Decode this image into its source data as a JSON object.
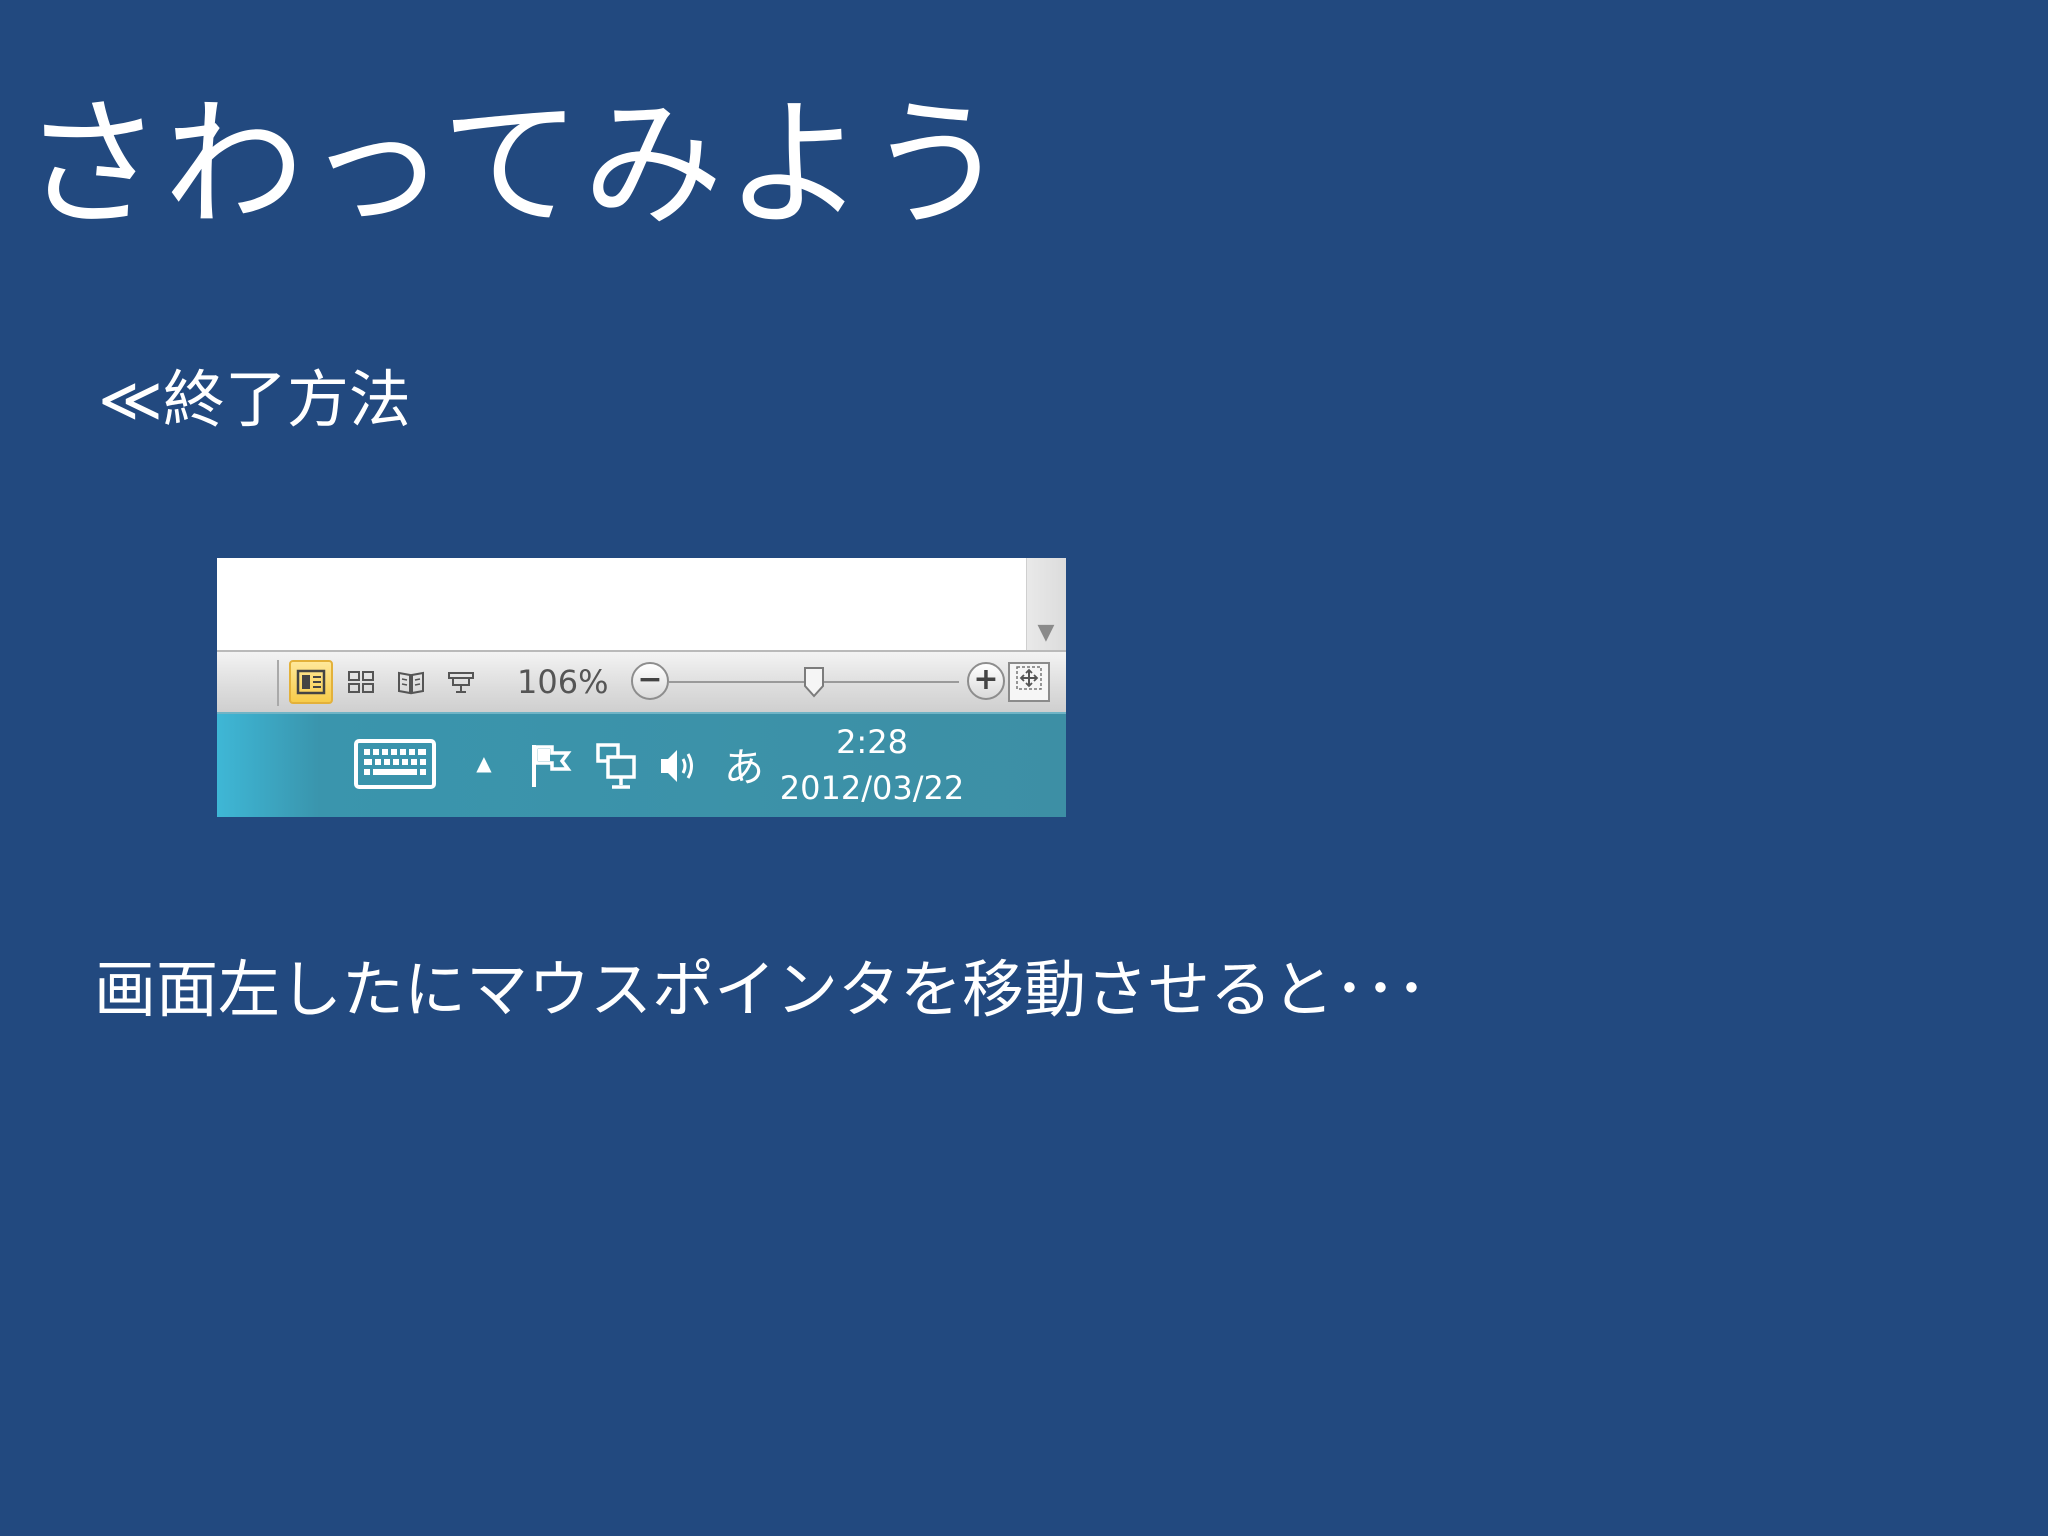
{
  "slide": {
    "title": "さわってみよう",
    "section": "≪終了方法",
    "caption": "画面左したにマウスポインタを移動させると･･･"
  },
  "status_bar": {
    "zoom_level": "106%",
    "zoom_minus": "−",
    "zoom_plus": "+",
    "zoom_slider_fraction": 0.5,
    "views": [
      "print-layout-view-icon",
      "full-screen-reading-view-icon",
      "web-layout-view-icon",
      "outline-view-icon"
    ]
  },
  "taskbar": {
    "ime_mode": "あ",
    "time": "2:28",
    "date": "2012/03/22",
    "show_hidden_icons": "▲",
    "icons": [
      "on-screen-keyboard-icon",
      "action-center-flag-icon",
      "network-icon",
      "volume-icon"
    ]
  },
  "colors": {
    "slide_background": "#22497f",
    "taskbar": "#3d8fa5",
    "active_view": "#f7cc4a"
  }
}
